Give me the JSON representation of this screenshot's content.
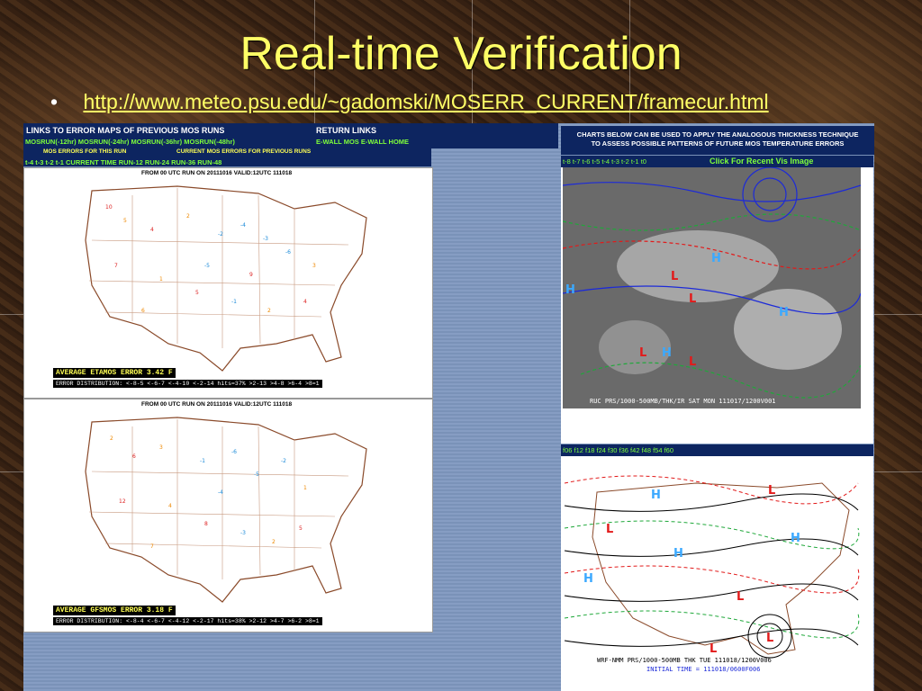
{
  "slide": {
    "title": "Real-time Verification",
    "bullet": "•",
    "url": "http://www.meteo.psu.edu/~gadomski/MOSERR_CURRENT/framecur.html"
  },
  "left": {
    "header_links": "LINKS TO ERROR MAPS OF PREVIOUS MOS RUNS",
    "return_links": "RETURN LINKS",
    "mosruns": "MOSRUN(-12hr)   MOSRUN(-24hr)   MOSRUN(-36hr)   MOSRUN(-48hr)",
    "wall_links": "E-WALL MOS    E-WALL HOME",
    "this_run": "MOS ERRORS FOR THIS RUN",
    "prev_runs": "CURRENT MOS ERRORS FOR PREVIOUS RUNS",
    "time_tabs": "t-4  t-3  t-2  t-1      CURRENT TIME      RUN-12  RUN-24  RUN-36  RUN-48",
    "map1_title": "FROM 00 UTC RUN ON 20111016 VALID:12UTC 111018",
    "map1_avg": "AVERAGE ETAMOS ERROR 3.42 F",
    "map1_dist": "ERROR DISTRIBUTION: <-8-5 <-6-7 <-4-10 <-2-14 hits=37% >2-13 >4-8 >6-4 >8=1",
    "map2_title": "FROM 00 UTC RUN ON 20111016 VALID:12UTC 111018",
    "map2_avg": "AVERAGE GFSMOS ERROR 3.18 F",
    "map2_dist": "ERROR DISTRIBUTION: <-8-4 <-6-7 <-4-12 <-2-17 hits=38% >2-12 >4-7 >6-2 >8=1"
  },
  "right": {
    "head_line1": "CHARTS BELOW CAN BE USED TO APPLY THE ANALOGOUS THICKNESS TECHNIQUE",
    "head_line2": "TO ASSESS POSSIBLE PATTERNS OF FUTURE MOS TEMPERATURE ERRORS",
    "time_tabs": "t-8  t-7  t-6  t-5  t-4  t-3  t-2  t-1  t0",
    "vis_link": "Click For Recent Vis Image",
    "sat_caption": "RUC PRS/1000-500MB/THK/IR SAT MON 111017/1200V001",
    "fcst_tabs": "f06 f12 f18 f24 f30 f36 f42 f48 f54 f60",
    "wrf_caption1": "WRF-NMM PRS/1000-500MB THK TUE 111018/1200V006",
    "wrf_caption2": "INITIAL TIME = 111018/0600F006"
  },
  "colors": {
    "title": "#ffff66",
    "navy": "#0d2560",
    "green_link": "#7fff3a",
    "frame": "#7f98c0"
  }
}
